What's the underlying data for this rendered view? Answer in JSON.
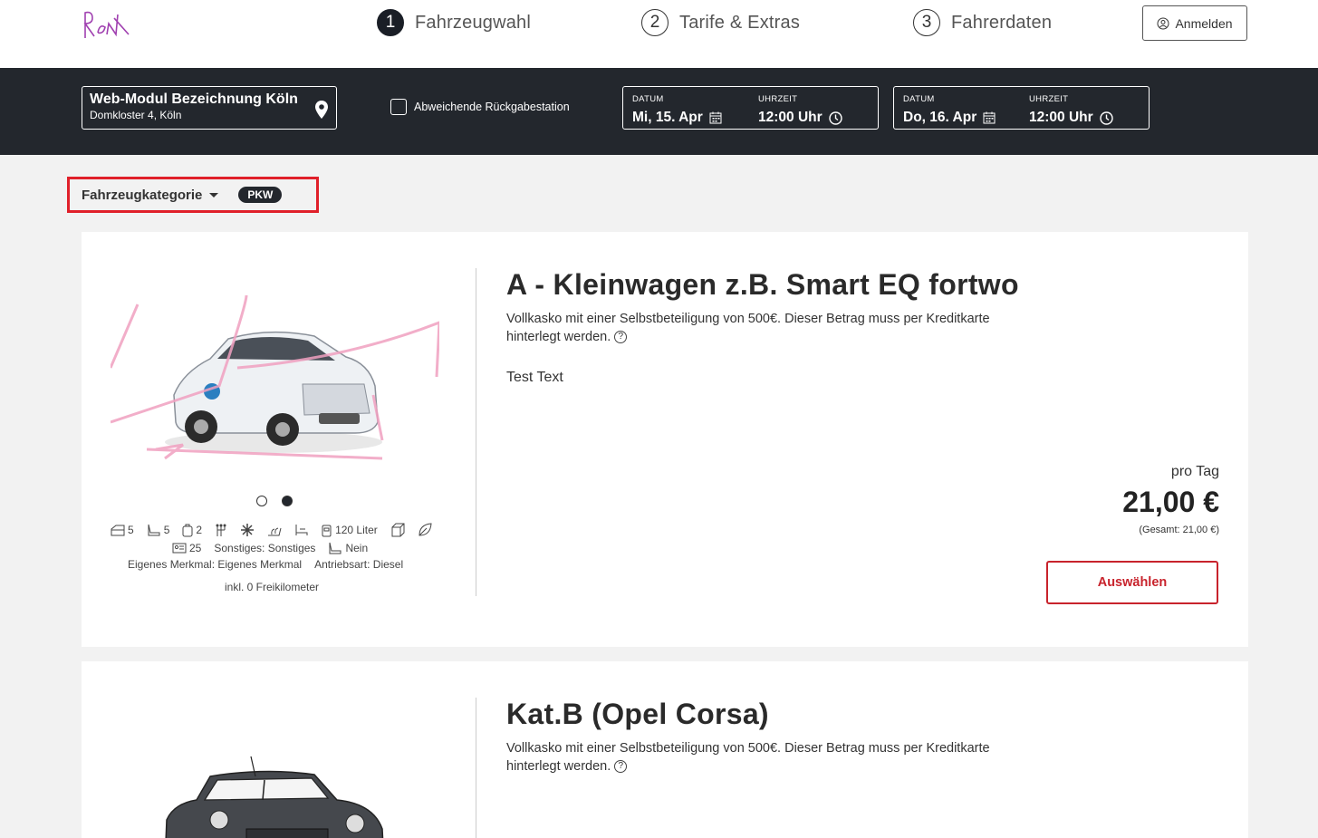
{
  "header": {
    "steps": [
      {
        "num": "1",
        "label": "Fahrzeugwahl",
        "active": true
      },
      {
        "num": "2",
        "label": "Tarife & Extras",
        "active": false
      },
      {
        "num": "3",
        "label": "Fahrerdaten",
        "active": false
      }
    ],
    "login_label": "Anmelden"
  },
  "search": {
    "location_name": "Web-Modul Bezeichnung Köln",
    "location_address": "Domkloster 4, Köln",
    "return_label": "Abweichende Rückgabestation",
    "pickup": {
      "date_caption": "DATUM",
      "date": "Mi, 15. Apr",
      "time_caption": "UHRZEIT",
      "time": "12:00 Uhr"
    },
    "dropoff": {
      "date_caption": "DATUM",
      "date": "Do, 16. Apr",
      "time_caption": "UHRZEIT",
      "time": "12:00 Uhr"
    }
  },
  "filter": {
    "label": "Fahrzeugkategorie",
    "badge": "PKW"
  },
  "vehicles": [
    {
      "title": "A - Kleinwagen z.B. Smart EQ fortwo",
      "insurance": "Vollkasko mit einer Selbstbeteiligung von 500€. Dieser Betrag muss per Kreditkarte hinterlegt werden.",
      "text": "Test Text",
      "features": {
        "doors": "5",
        "seats": "5",
        "bags": "2",
        "tank": "120 Liter",
        "age": "25",
        "misc": "Sonstiges: Sonstiges",
        "child_seat": "Nein",
        "own_feature": "Eigenes Merkmal: Eigenes Merkmal",
        "drive": "Antriebsart: Diesel",
        "km": "inkl. 0 Freikilometer"
      },
      "price_caption": "pro Tag",
      "price": "21,00 €",
      "total": "(Gesamt: 21,00 €)",
      "select_label": "Auswählen"
    },
    {
      "title": "Kat.B (Opel Corsa)",
      "insurance": "Vollkasko mit einer Selbstbeteiligung von 500€. Dieser Betrag muss per Kreditkarte hinterlegt werden."
    }
  ],
  "colors": {
    "dark": "#23272d",
    "accent": "#c8232c",
    "highlight": "#e0202a"
  }
}
